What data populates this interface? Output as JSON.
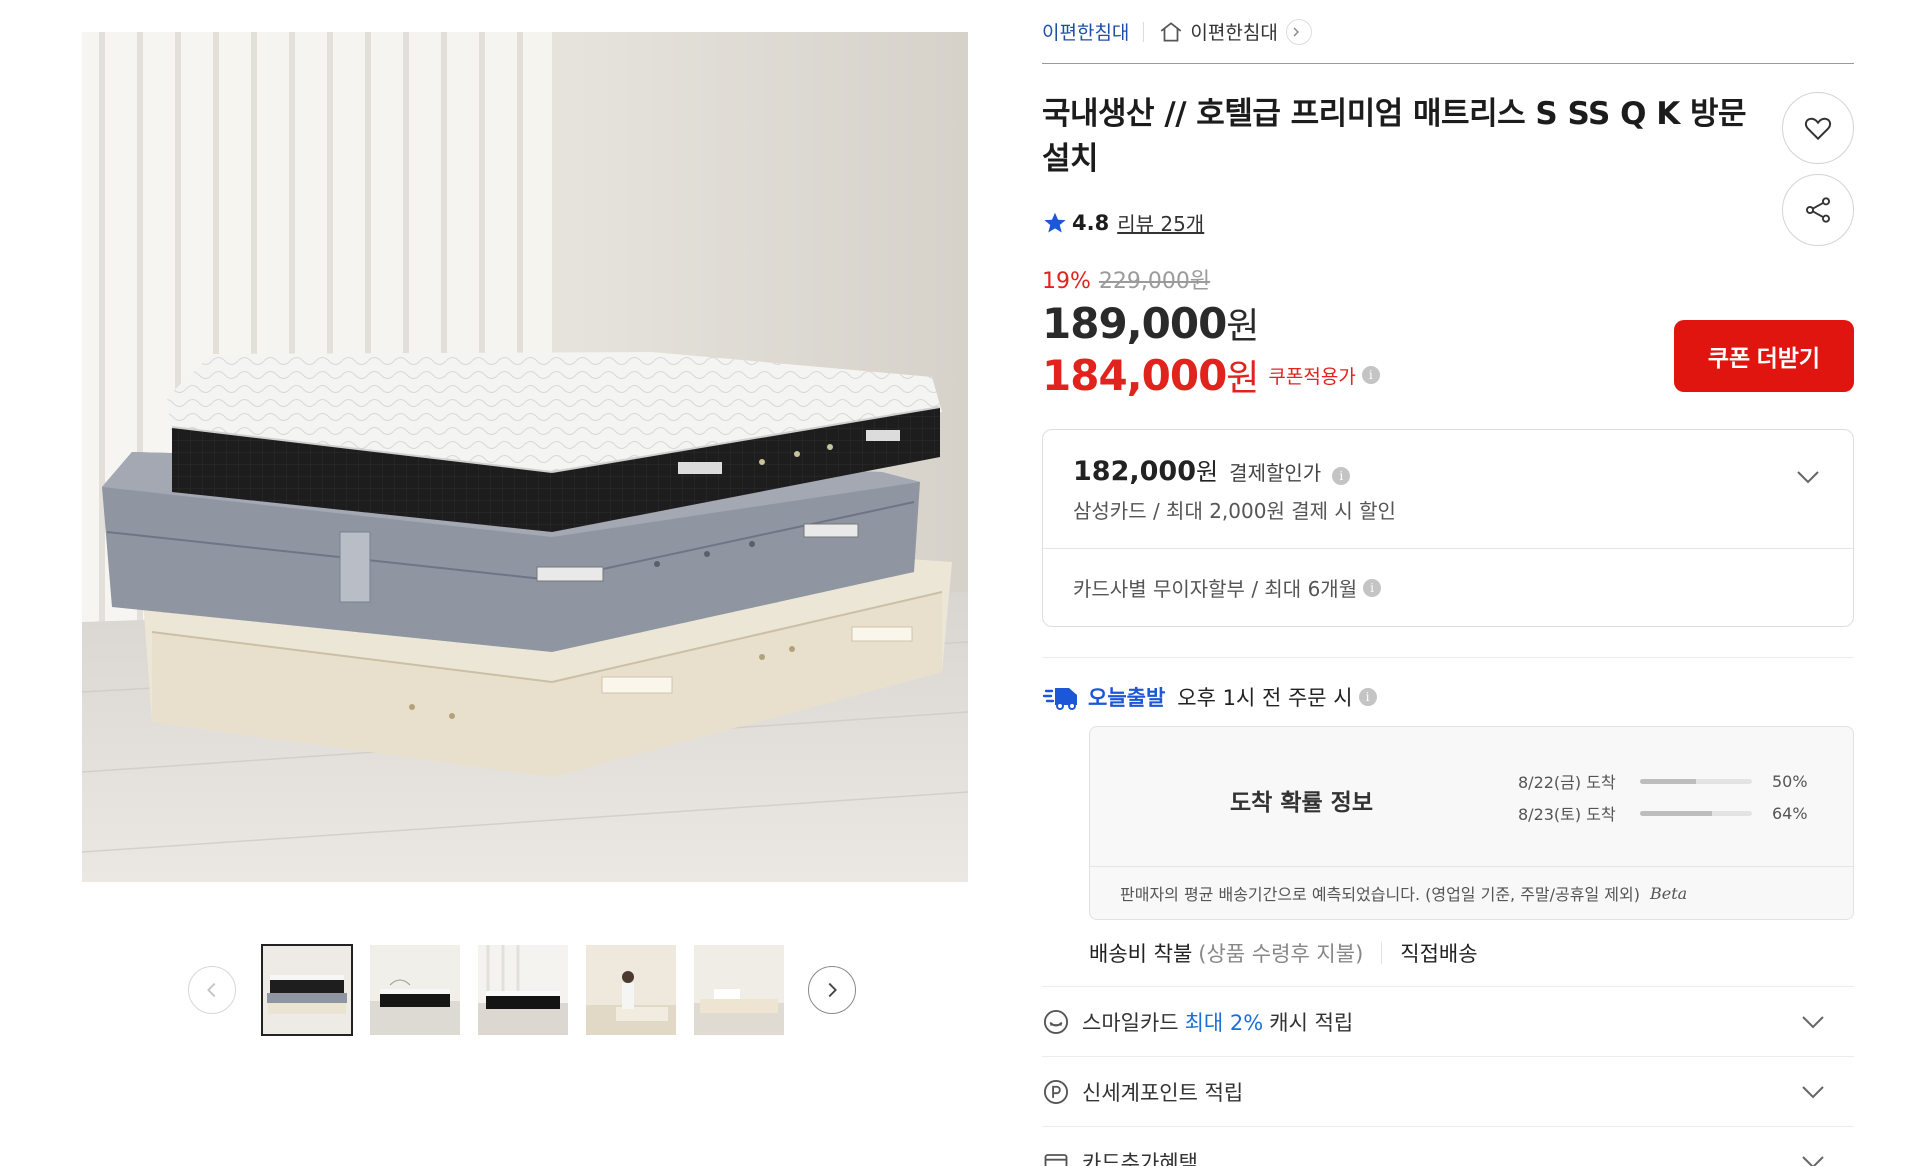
{
  "breadcrumb": {
    "store": "이편한침대",
    "home_store": "이편한침대"
  },
  "product": {
    "title": "국내생산 // 호텔급 프리미엄 매트리스 S SS Q K 방문설치",
    "rating": "4.8",
    "reviews": "리뷰 25개"
  },
  "price": {
    "discount_rate": "19%",
    "original": "229,000원",
    "sale_number": "189,000",
    "coupon_number": "184,000",
    "won": "원",
    "coupon_label": "쿠폰적용가",
    "coupon_button": "쿠폰 더받기"
  },
  "payment": {
    "price_number": "182,000",
    "won": "원",
    "label": "결제할인가",
    "card_note": "삼성카드 / 최대 2,000원 결제 시 할인",
    "installment": "카드사별 무이자할부 / 최대 6개월"
  },
  "shipping": {
    "today_label": "오늘출발",
    "condition": "오후 1시 전 주문 시",
    "arrival_title": "도착 확률 정보",
    "probabilities": [
      {
        "date": "8/22(금) 도착",
        "percent_label": "50%",
        "percent": 50
      },
      {
        "date": "8/23(토) 도착",
        "percent_label": "64%",
        "percent": 64
      }
    ],
    "note": "판매자의 평균 배송기간으로 예측되었습니다. (영업일 기준, 주말/공휴일 제외)",
    "beta": "Beta",
    "fee": "배송비 착불",
    "fee_note": "(상품 수령후 지불)",
    "method": "직접배송"
  },
  "benefits": {
    "smile_prefix": "스마일카드",
    "smile_accent": "최대 2%",
    "smile_suffix": "캐시 적립",
    "point": "신세계포인트 적립",
    "card_extra": "카드추가혜택"
  },
  "icons": {
    "wish": "heart-icon",
    "share": "share-icon",
    "star": "star-icon",
    "home": "home-icon",
    "truck": "truck-icon"
  },
  "colors": {
    "accent_red": "#e1150f",
    "link_blue": "#1e4fa6",
    "today_blue": "#1b57d6",
    "star_blue": "#1b57d6"
  }
}
